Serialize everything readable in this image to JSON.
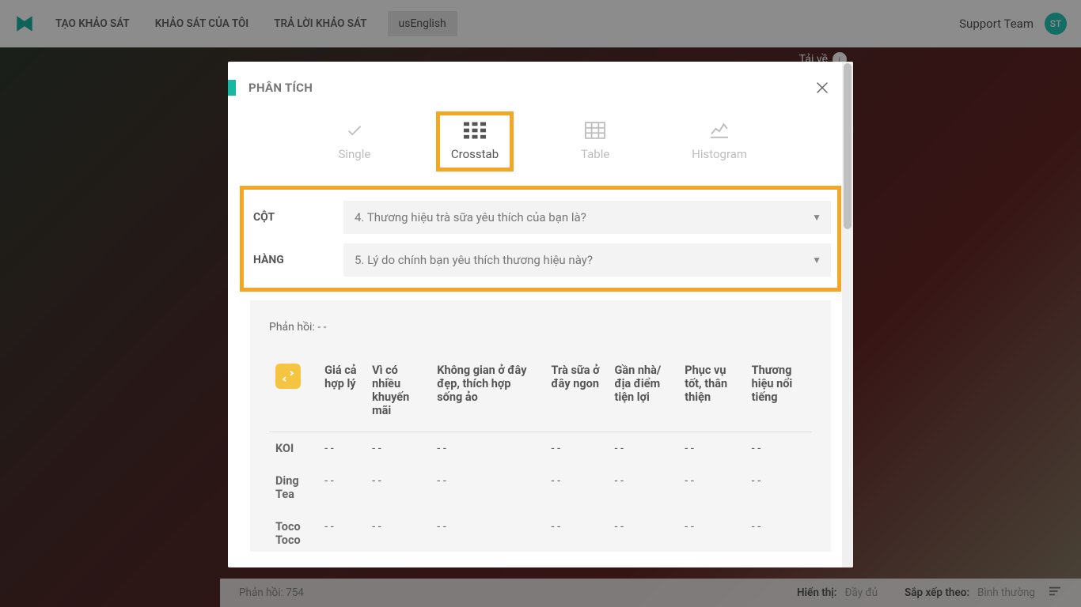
{
  "topbar": {
    "nav": [
      "TẠO KHẢO SÁT",
      "KHẢO SÁT CỦA TÔI",
      "TRẢ LỜI KHẢO SÁT"
    ],
    "lang_btn": "usEnglish",
    "support": "Support Team",
    "avatar_initials": "ST"
  },
  "download_label": "Tải về",
  "modal": {
    "title": "PHÂN TÍCH",
    "tabs": [
      {
        "label": "Single"
      },
      {
        "label": "Crosstab"
      },
      {
        "label": "Table"
      },
      {
        "label": "Histogram"
      }
    ],
    "column_label": "CỘT",
    "column_value": "4. Thương hiệu trà sữa yêu thích của bạn là?",
    "row_label": "HÀNG",
    "row_value": "5. Lý do chính bạn yêu thích thương hiệu này?",
    "response_prefix": "Phản hồi:",
    "response_value": "- -",
    "headers": [
      "Giá cả hợp lý",
      "Vì có nhiều khuyến mãi",
      "Không gian ở đây đẹp, thích hợp sống ảo",
      "Trà sữa ở đây ngon",
      "Gần nhà/ địa điểm tiện lợi",
      "Phục vụ tốt, thân thiện",
      "Thương hiệu nổi tiếng"
    ],
    "rows": [
      {
        "label": "KOI",
        "cells": [
          "- -",
          "- -",
          "- -",
          "- -",
          "- -",
          "- -",
          "- -"
        ]
      },
      {
        "label": "Ding Tea",
        "cells": [
          "- -",
          "- -",
          "- -",
          "- -",
          "- -",
          "- -",
          "- -"
        ]
      },
      {
        "label": "Toco Toco",
        "cells": [
          "- -",
          "- -",
          "- -",
          "- -",
          "- -",
          "- -",
          "- -"
        ]
      }
    ]
  },
  "footer": {
    "left": "Phản hồi: 754",
    "display_label": "Hiển thị:",
    "display_value": "Đầy đủ",
    "sort_label": "Sắp xếp theo:",
    "sort_value": "Bình thường"
  }
}
